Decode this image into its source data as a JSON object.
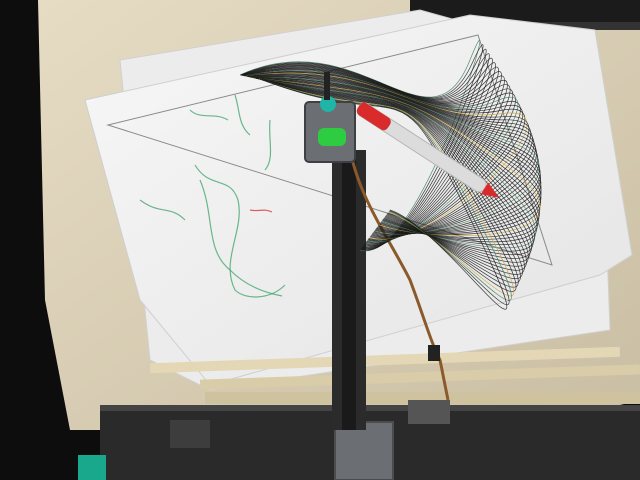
{
  "scene": {
    "subject": "pen-plotter-drawing-on-paper",
    "colors": {
      "background_dark": "#0d0d0d",
      "wood_table": "#d8cfb8",
      "paper": "#f2f2f2",
      "ink_black": "#1a1a1a",
      "plotter_gray": "#6b6e72",
      "knob_teal": "#1fb5a8",
      "clip_green": "#2ecc40",
      "pen_red": "#d92b2b",
      "pen_body": "#dcdcdc",
      "green_sketch": "#3aa36a",
      "cable_brown": "#8a5a2b"
    }
  }
}
